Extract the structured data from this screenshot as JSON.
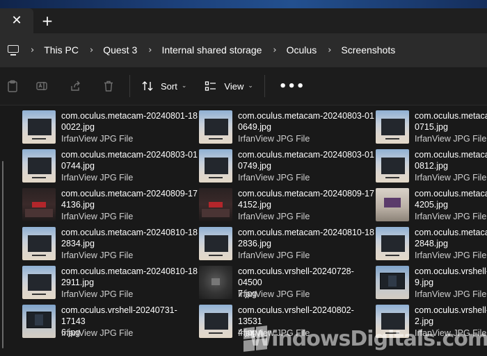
{
  "tabbar": {
    "close_glyph": "✕",
    "add_glyph": "+"
  },
  "address": {
    "separator": "›",
    "breadcrumbs": [
      "This PC",
      "Quest 3",
      "Internal shared storage",
      "Oculus",
      "Screenshots"
    ]
  },
  "toolbar": {
    "sort_label": "Sort",
    "view_label": "View",
    "more_glyph": "•••",
    "icons": [
      "paste-icon",
      "rename-icon",
      "share-icon",
      "delete-icon"
    ]
  },
  "files": [
    {
      "name": "com.oculus.metacam-20240801-18\n0022.jpg",
      "type": "IrfanView JPG File",
      "thumb": "sky"
    },
    {
      "name": "com.oculus.metacam-20240803-01\n0649.jpg",
      "type": "IrfanView JPG File",
      "thumb": "sky"
    },
    {
      "name": "com.oculus.metaca\n0715.jpg",
      "type": "IrfanView JPG File",
      "thumb": "sky"
    },
    {
      "name": "com.oculus.metacam-20240803-01\n0744.jpg",
      "type": "IrfanView JPG File",
      "thumb": "sky"
    },
    {
      "name": "com.oculus.metacam-20240803-01\n0749.jpg",
      "type": "IrfanView JPG File",
      "thumb": "sky"
    },
    {
      "name": "com.oculus.metaca\n0812.jpg",
      "type": "IrfanView JPG File",
      "thumb": "sky"
    },
    {
      "name": "com.oculus.metacam-20240809-17\n4136.jpg",
      "type": "IrfanView JPG File",
      "thumb": "dark"
    },
    {
      "name": "com.oculus.metacam-20240809-17\n4152.jpg",
      "type": "IrfanView JPG File",
      "thumb": "dark"
    },
    {
      "name": "com.oculus.metaca\n4205.jpg",
      "type": "IrfanView JPG File",
      "thumb": "room"
    },
    {
      "name": "com.oculus.metacam-20240810-18\n2834.jpg",
      "type": "IrfanView JPG File",
      "thumb": "sky"
    },
    {
      "name": "com.oculus.metacam-20240810-18\n2836.jpg",
      "type": "IrfanView JPG File",
      "thumb": "sky"
    },
    {
      "name": "com.oculus.metaca\n2848.jpg",
      "type": "IrfanView JPG File",
      "thumb": "sky"
    },
    {
      "name": "com.oculus.metacam-20240810-18\n2911.jpg",
      "type": "IrfanView JPG File",
      "thumb": "sky"
    },
    {
      "name": "com.oculus.vrshell-20240728-04500\n7.jpg",
      "type": "IrfanView JPG File",
      "thumb": "black"
    },
    {
      "name": "com.oculus.vrshell-\n9.jpg",
      "type": "IrfanView JPG File",
      "thumb": "vr"
    },
    {
      "name": "com.oculus.vrshell-20240731-17143\n6.jpg",
      "type": "IrfanView JPG File",
      "thumb": "vr"
    },
    {
      "name": "com.oculus.vrshell-20240802-13531\n4.jpg",
      "type": "IrfanView JPG File",
      "thumb": "sky"
    },
    {
      "name": "com.oculus.vrshell-\n2.jpg",
      "type": "IrfanView JPG File",
      "thumb": "sky"
    }
  ],
  "watermark": {
    "text": "WindowsDigitals.com"
  },
  "colors": {
    "background": "#191919",
    "addressbar": "#2b2b2b",
    "text": "#ffffff",
    "secondary_text": "#cfcfcf"
  }
}
